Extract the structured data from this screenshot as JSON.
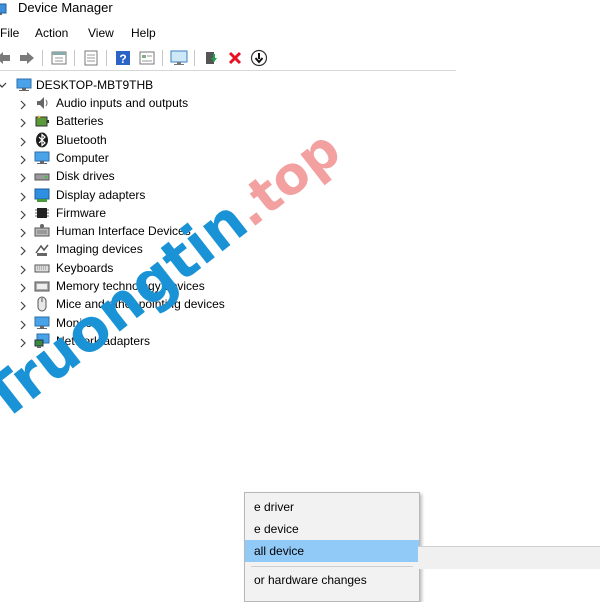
{
  "window": {
    "title": "Device Manager"
  },
  "menu": [
    "File",
    "Action",
    "View",
    "Help"
  ],
  "toolbar": {
    "icons": [
      "back-icon",
      "forward-icon",
      "properties-icon",
      "list-view-icon",
      "help-icon",
      "details-icon",
      "scan-monitor-icon",
      "update-driver-icon",
      "uninstall-icon",
      "disable-icon"
    ]
  },
  "tree": {
    "root": "DESKTOP-MBT9THB",
    "items": [
      {
        "label": "Audio inputs and outputs",
        "icon": "speaker-icon"
      },
      {
        "label": "Batteries",
        "icon": "battery-icon"
      },
      {
        "label": "Bluetooth",
        "icon": "bluetooth-icon"
      },
      {
        "label": "Computer",
        "icon": "computer-icon"
      },
      {
        "label": "Disk drives",
        "icon": "disk-drive-icon"
      },
      {
        "label": "Display adapters",
        "icon": "display-adapter-icon"
      },
      {
        "label": "Firmware",
        "icon": "firmware-icon"
      },
      {
        "label": "Human Interface Devices",
        "icon": "hid-icon"
      },
      {
        "label": "Imaging devices",
        "icon": "camera-icon"
      },
      {
        "label": "Keyboards",
        "icon": "keyboard-icon"
      },
      {
        "label": "Memory technology devices",
        "icon": "memory-icon"
      },
      {
        "label": "Mice and other pointing devices",
        "icon": "mouse-icon"
      },
      {
        "label": "Monitors",
        "icon": "monitor-icon"
      },
      {
        "label": "Network adapters",
        "icon": "network-adapter-icon"
      }
    ]
  },
  "context_menu": {
    "items": [
      "e driver",
      "e device",
      "all device",
      "or hardware changes"
    ],
    "highlighted": "all device"
  },
  "watermark": {
    "main": "Truongtin",
    "suffix": ".top"
  },
  "colors": {
    "highlight": "#91c9f7",
    "watermark_blue": "#1a93d6",
    "watermark_pink": "#f2a0a0",
    "uninstall_red": "#e81123"
  }
}
